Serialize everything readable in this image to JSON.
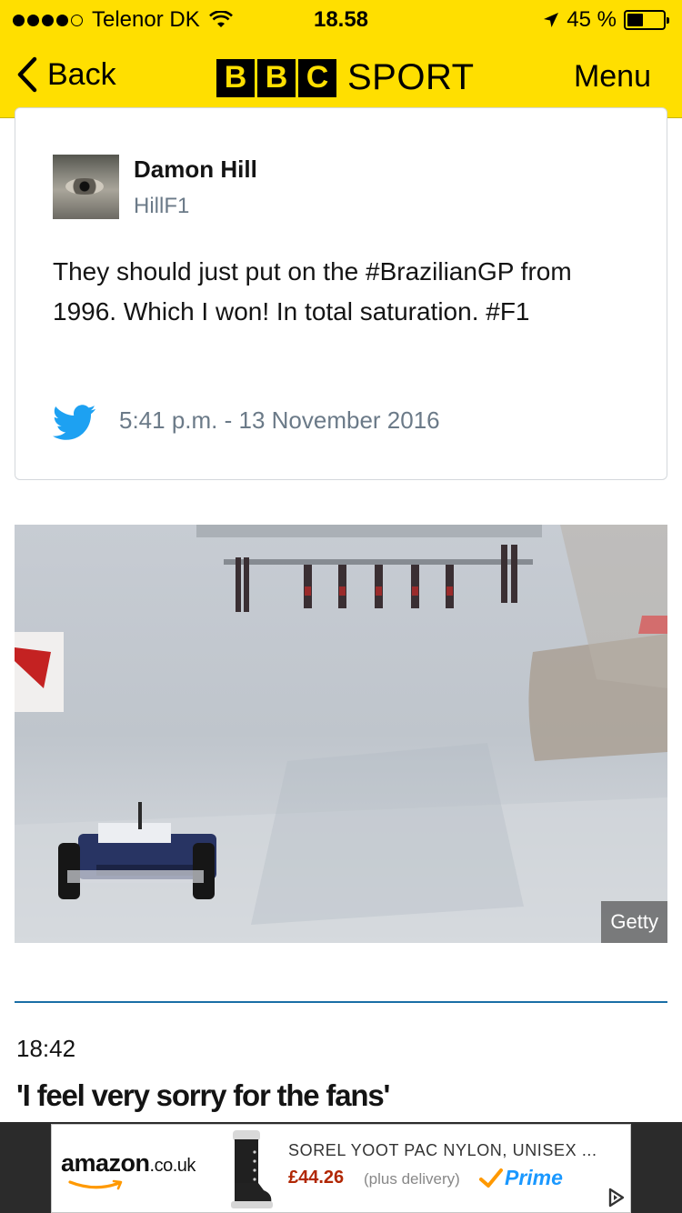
{
  "status_bar": {
    "carrier": "Telenor DK",
    "time": "18.58",
    "battery_percent": "45 %",
    "battery_level": 0.45,
    "signal_bars": 4
  },
  "nav": {
    "back_label": "Back",
    "logo_letters": [
      "B",
      "B",
      "C"
    ],
    "logo_word": "SPORT",
    "menu_label": "Menu"
  },
  "tweet": {
    "author_name": "Damon Hill",
    "author_handle": "HillF1",
    "text": "They should just put on the #BrazilianGP from 1996. Which I won! In total saturation. #F1",
    "timestamp": "5:41 p.m. - 13 November 2016",
    "icon": "twitter-bird-icon"
  },
  "photo": {
    "credit": "Getty"
  },
  "live_entry": {
    "time": "18:42",
    "headline": "'I feel very sorry for the fans'"
  },
  "ad": {
    "brand": "amazon",
    "brand_suffix": ".co.uk",
    "product": "SOREL YOOT PAC NYLON, UNISEX ...",
    "price": "£44.26",
    "delivery": "(plus delivery)",
    "prime": "Prime"
  },
  "colors": {
    "header_yellow": "#ffdf00",
    "divider_blue": "#1a6ea6",
    "twitter_blue": "#1da1f2",
    "price_red": "#b12704",
    "prime_blue": "#1a98ff"
  }
}
